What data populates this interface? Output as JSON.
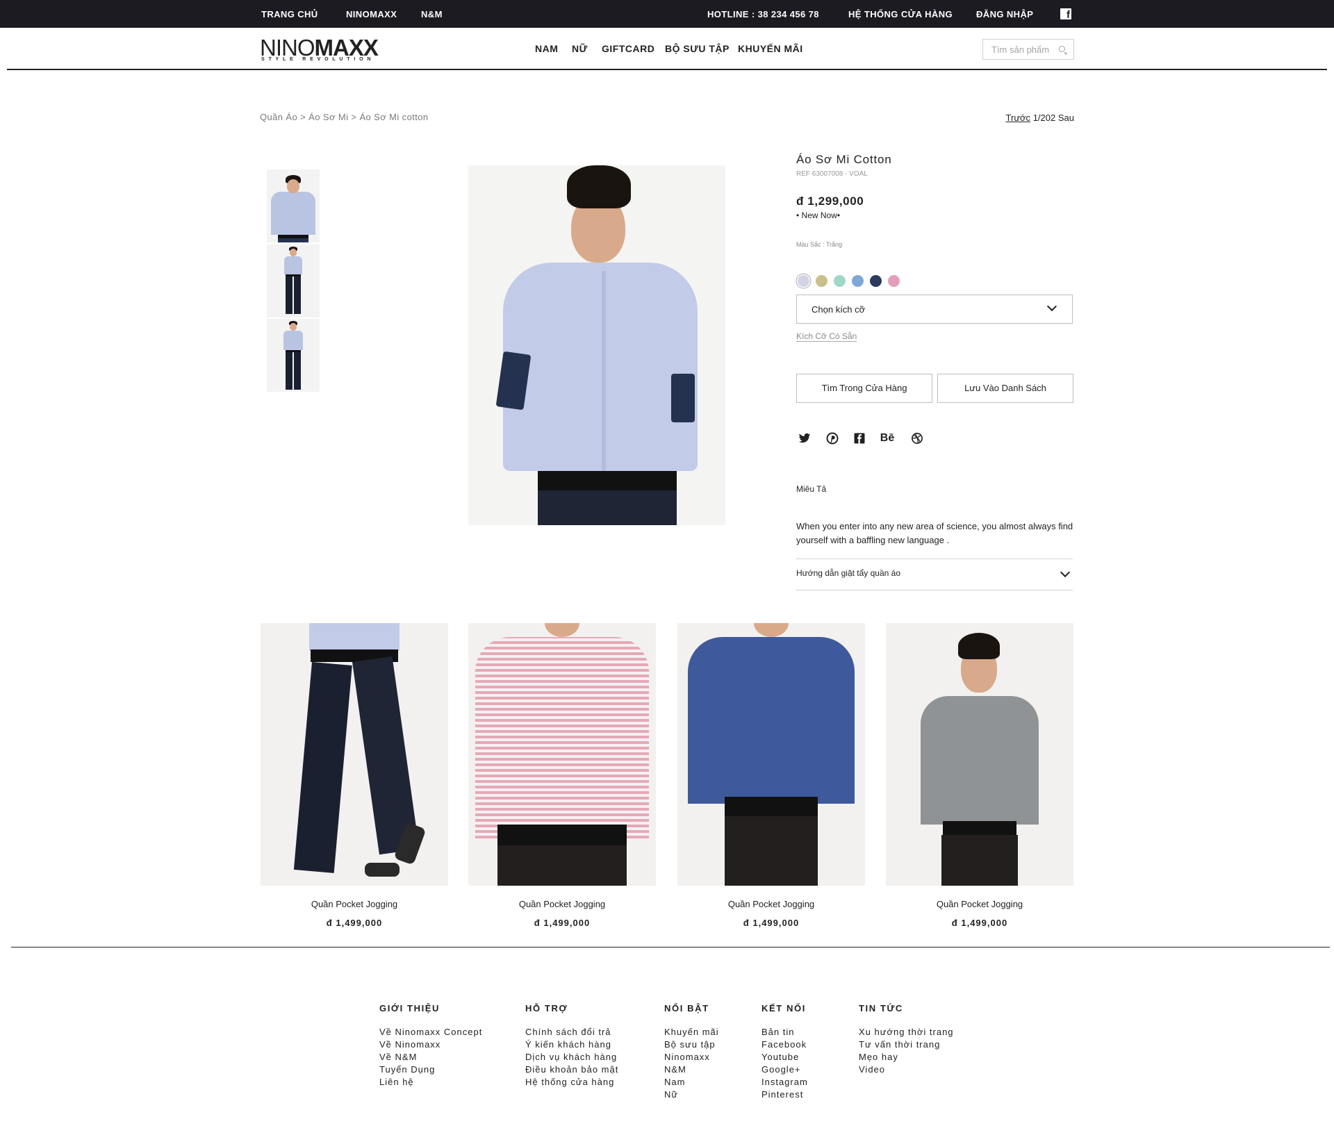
{
  "topbar": {
    "links": [
      "TRANG CHỦ",
      "NINOMAXX",
      "N&M"
    ],
    "hotline": "HOTLINE : 38 234 456 78",
    "stores": "HỆ THỐNG CỬA HÀNG",
    "login": "ĐĂNG NHẬP"
  },
  "header": {
    "logo_thin": "NINO",
    "logo_bold": "MAXX",
    "logo_tagline": "STYLE REVOLUTION",
    "nav": [
      "NAM",
      "NỮ",
      "GIFTCARD",
      "BỘ SƯU TẬP",
      "KHUYẾN MÃI"
    ],
    "search_placeholder": "Tìm sản phẩm"
  },
  "breadcrumb": {
    "items": [
      "Quần Áo",
      "Áo Sơ Mi",
      "Áo Sơ Mi cotton"
    ],
    "separator": ">"
  },
  "pager": {
    "prev": "Trước",
    "position": "1/202",
    "next": "Sau"
  },
  "product": {
    "title": "Áo Sơ Mi Cotton",
    "ref": "REF 63007008 - VOAL",
    "price": "đ 1,299,000",
    "badge": "• New Now•",
    "color_label": "Màu Sắc : Trắng",
    "swatches": [
      "#d3d3e6",
      "#c9c08a",
      "#9fd8c8",
      "#7fa8d8",
      "#2c3a5e",
      "#e39fb9"
    ],
    "selected_swatch": 0,
    "size_select": "Chọn kích cỡ",
    "sizes_link": "Kích Cỡ Có Sẵn",
    "find_in_store": "Tìm Trong Cửa Hàng",
    "save_to_list": "Lưu Vào Danh Sách",
    "social_icons": [
      "twitter-icon",
      "pinterest-icon",
      "facebook-icon",
      "behance-icon",
      "dribbble-icon"
    ],
    "behance_text": "Bē",
    "description_title": "Miêu Tả",
    "description": "When you enter into any new area of science, you almost always find yourself with a baffling new language .",
    "care_guide": "Hướng dẫn giặt tẩy quần áo"
  },
  "related": [
    {
      "name": "Quần Pocket Jogging",
      "price": "đ 1,499,000"
    },
    {
      "name": "Quần Pocket Jogging",
      "price": "đ 1,499,000"
    },
    {
      "name": "Quần Pocket Jogging",
      "price": "đ 1,499,000"
    },
    {
      "name": "Quần Pocket Jogging",
      "price": "đ 1,499,000"
    }
  ],
  "footer": {
    "columns": [
      {
        "title": "GIỚI THIỆU",
        "links": [
          "Về Ninomaxx Concept",
          "Về Ninomaxx",
          "Về N&M",
          "Tuyển Dụng",
          "Liên hệ"
        ]
      },
      {
        "title": "HỖ TRỢ",
        "links": [
          "Chính sách đổi trả",
          "Ý kiến khách hàng",
          "Dịch vụ khách hàng",
          "Điều khoản bảo mật",
          "Hệ thống cửa hàng"
        ]
      },
      {
        "title": "NỔI BẬT",
        "links": [
          "Khuyến mãi",
          "Bộ sưu tập",
          "Ninomaxx",
          "N&M",
          "Nam",
          "Nữ"
        ]
      },
      {
        "title": "KẾT NỐI",
        "links": [
          "Bản tin",
          "Facebook",
          "Youtube",
          "Google+",
          "Instagram",
          "Pinterest"
        ]
      },
      {
        "title": "TIN TỨC",
        "links": [
          "Xu hướng thời trang",
          "Tư vấn thời trang",
          "Mẹo hay",
          "Video"
        ]
      }
    ]
  }
}
